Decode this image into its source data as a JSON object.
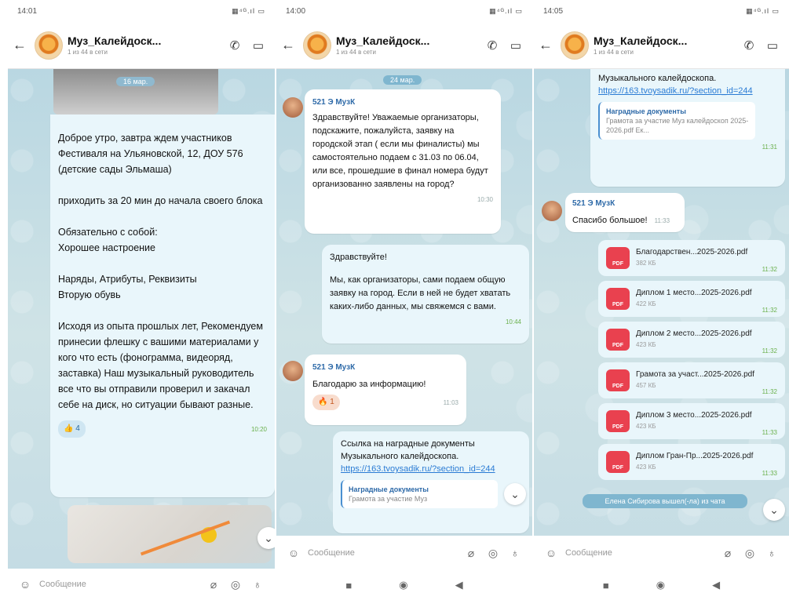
{
  "panel1": {
    "status_time": "14:01",
    "status_ind": "▦⁴ᴳ.ıl ▭",
    "title": "Муз_Калейдоск...",
    "subtitle": "1 из 44 в сети",
    "photo_date": "16 мар.",
    "msg": [
      "Доброе утро, завтра ждем участников Фестиваля на Ульяновской, 12, ДОУ 576 (детские сады Эльмаша)",
      "приходить за 20 мин до начала своего блока",
      "Обязательно с собой:",
      "Хорошее настроение",
      "Наряды, Атрибуты, Реквизиты",
      "Вторую обувь",
      "Исходя из опыта прошлых лет, Рекомендуем принесии флешку с вашими материалами у кого что есть (фонограмма, видеоряд, заставка) Наш музыкальный руководитель все что вы отправили проверил и закачал себе на диск, но ситуации бывают разные."
    ],
    "reaction": "👍 4",
    "time": "10:20",
    "input_placeholder": "Сообщение"
  },
  "panel2": {
    "status_time": "14:00",
    "status_ind": "▦⁴ᴳ.ıl ▭",
    "title": "Муз_Калейдоск...",
    "subtitle": "1 из 44 в сети",
    "date_pill": "24 мар.",
    "sender1": "521 Э МузК",
    "msg1": "Здравствуйте! Уважаемые организаторы, подскажите, пожалуйста, заявку на городской этап ( если мы финалисты) мы самостоятельно подаем с 31.03 по 06.04, или все, прошедшие в финал номера будут организованно заявлены на город?",
    "time1": "10:30",
    "msg2a": "Здравствуйте!",
    "msg2b": "Мы, как организаторы, сами подаем общую заявку на город. Если в ней не будет хватать каких-либо данных, мы свяжемся с вами.",
    "time2": "10:44",
    "sender3": "521 Э МузК",
    "msg3": "Благодарю за информацию!",
    "reaction3": "🔥 1",
    "time3": "11:03",
    "msg4": "Ссылка на наградные документы Музыкального калейдоскопа.",
    "link4": "https://163.tvoysadik.ru/?section_id=244",
    "preview_title": "Наградные документы",
    "preview_sub": "Грамота за участие Муз",
    "input_placeholder": "Сообщение"
  },
  "panel3": {
    "status_time": "14:05",
    "status_ind": "▦⁴ᴳ.ıl ▭",
    "title": "Муз_Калейдоск...",
    "subtitle": "1 из 44 в сети",
    "top_text": "Музыкального калейдоскопа.",
    "top_link": "https://163.tvoysadik.ru/?section_id=244",
    "preview_title": "Наградные документы",
    "preview_sub": "Грамота за участие Муз калейдоскоп 2025-2026.pdf Ек...",
    "preview_time": "11:31",
    "sender": "521 Э МузК",
    "thanks": "Спасибо большое!",
    "thanks_time": "11:33",
    "files": [
      {
        "name": "Благодарствен...2025-2026.pdf",
        "size": "382 КБ",
        "time": "11:32"
      },
      {
        "name": "Диплом 1 место...2025-2026.pdf",
        "size": "422 КБ",
        "time": "11:32"
      },
      {
        "name": "Диплом 2 место...2025-2026.pdf",
        "size": "423 КБ",
        "time": "11:32"
      },
      {
        "name": "Грамота за участ...2025-2026.pdf",
        "size": "457 КБ",
        "time": "11:32"
      },
      {
        "name": "Диплом 3 место...2025-2026.pdf",
        "size": "423 КБ",
        "time": "11:33"
      },
      {
        "name": "Диплом Гран-Пр...2025-2026.pdf",
        "size": "423 КБ",
        "time": "11:33"
      }
    ],
    "system_msg": "Елена Сибирова вышел(-ла) из чата",
    "input_placeholder": "Сообщение"
  },
  "pdf_label": "PDF"
}
